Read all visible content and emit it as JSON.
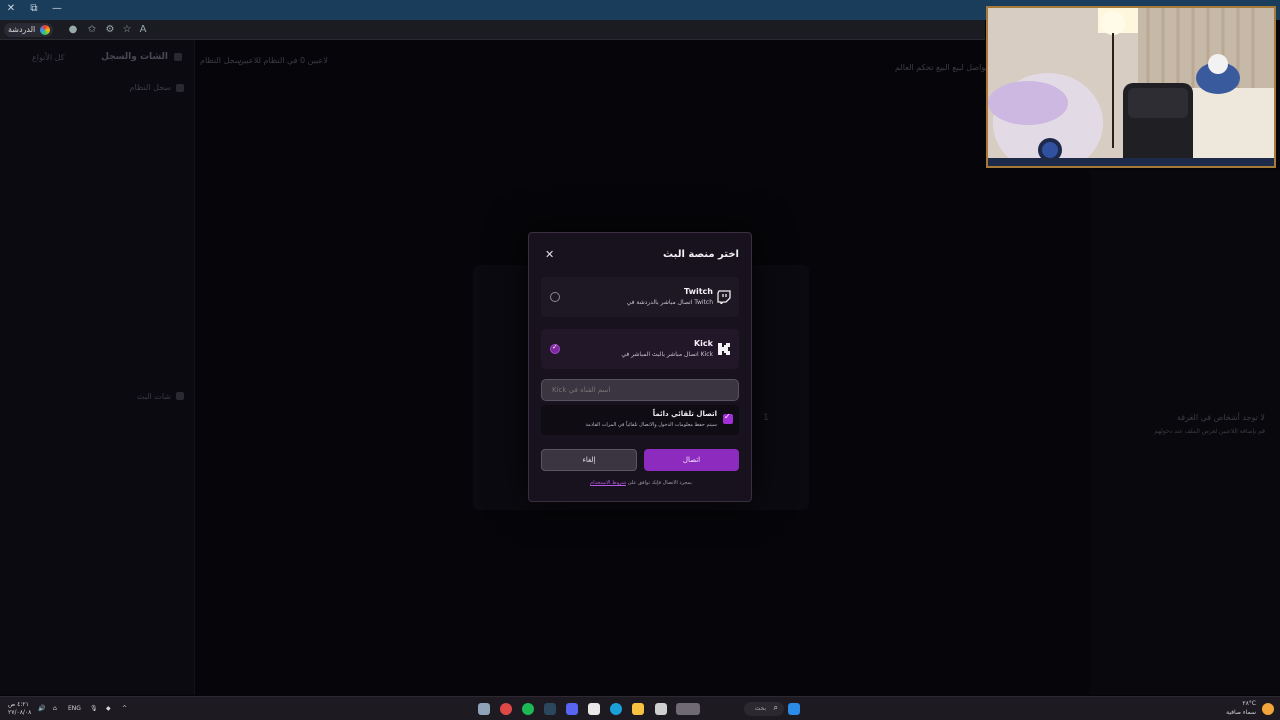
{
  "modal": {
    "title": "اختر منصة البث",
    "close_icon": "close-icon",
    "options": [
      {
        "name": "Twitch",
        "desc": "اتصال مباشر بالدردشة في Twitch",
        "icon": "twitch-icon",
        "selected": false
      },
      {
        "name": "Kick",
        "desc": "اتصال مباشر بالبث المباشر في Kick",
        "icon": "kick-icon",
        "selected": true
      }
    ],
    "channel_input": {
      "placeholder": "اسم القناة في Kick",
      "value": ""
    },
    "auto_connect": {
      "label": "اتصال تلقائي دائماً",
      "desc": "سيتم حفظ معلومات الدخول والاتصال تلقائياً في المرات القادمة",
      "checked": true
    },
    "cancel_label": "إلغاء",
    "connect_label": "اتصال",
    "terms_prefix": "بمجرد الاتصال فإنك توافق على",
    "terms_link": "شروط الاستخدام"
  },
  "browser": {
    "chat_tab": "الدردشة"
  },
  "sidebar": {
    "title": "الشات والسجل",
    "system_log": "سجل النظام",
    "stream_chat": "شات البث",
    "filter": "كل الأنواع"
  },
  "header": {
    "crumbs": [
      "0 لاعبين",
      "في النظام للاعبين",
      "سجل النظام"
    ],
    "right_note": "لنقاط والمواصل لبيع البيع تحكم العالم"
  },
  "center": {
    "badge": "1"
  },
  "right_panel": {
    "line1": "لا توجد أشخاص في الغرفة",
    "line2": "قم بإضافة اللاعبين لعرض الملف عند دخولهم"
  },
  "taskbar": {
    "time": "٤:٢١ ص",
    "date": "٢٧/٠٨/٠٨",
    "lang": "ENG",
    "search": "بحث",
    "weather_temp": "٢٨°C",
    "weather_desc": "سماء صافية"
  },
  "colors": {
    "accent": "#8e2bbf",
    "modal_bg": "#17121d",
    "page_bg": "#050408"
  }
}
